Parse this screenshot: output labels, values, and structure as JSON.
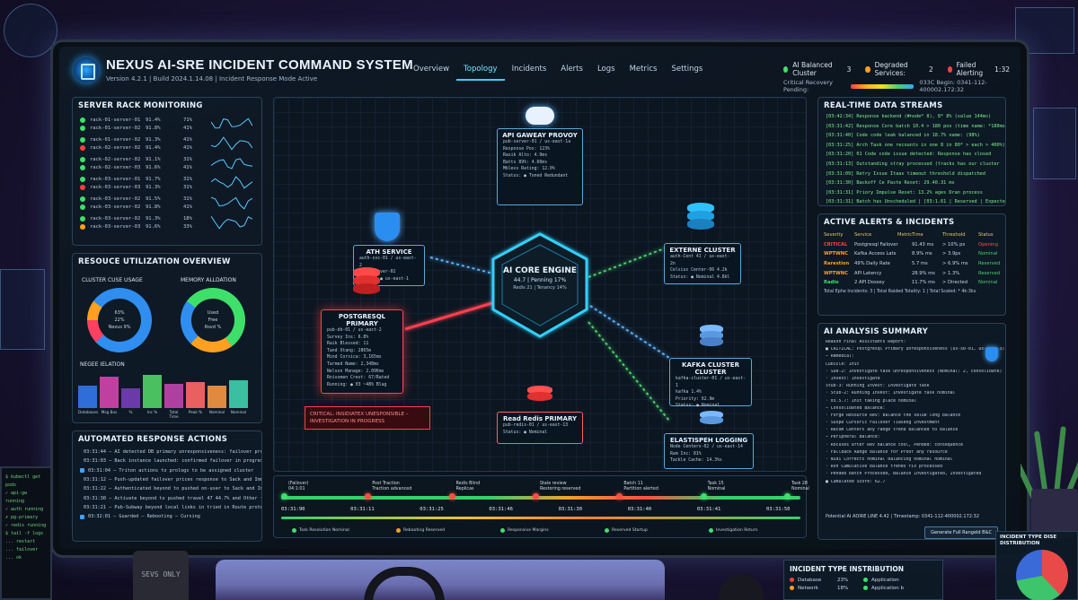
{
  "header": {
    "title": "NEXUS AI-SRE INCIDENT COMMAND SYSTEM",
    "subtitle": "Version 4.2.1  |  Build 2024.1.14.08  |  Incident Response Mode Active",
    "nav": [
      "Overview",
      "Topology",
      "Incidents",
      "Alerts",
      "Logs",
      "Metrics",
      "Settings"
    ],
    "active_nav": "Topology",
    "status": [
      {
        "label": "AI Balanced Cluster",
        "value": "3",
        "color": "#3ee06a"
      },
      {
        "label": "Degraded Services:",
        "value": "2",
        "color": "#ffa020"
      },
      {
        "label": "Failed Alerting",
        "value": "1:32",
        "color": "#ff4040"
      }
    ],
    "status2_label": "Critical Recovery Pending:",
    "status2_tail": "033C Begin: 0341-112-400002.172:32"
  },
  "server_rack": {
    "title": "SERVER RACK MONITORING",
    "groups": [
      [
        {
          "name": "rack-01-server-01",
          "v1": "91.4%",
          "v2": "71%",
          "color": "#3ee06a"
        },
        {
          "name": "rack-01-server-02",
          "v1": "91.8%",
          "v2": "41%",
          "color": "#3ee06a"
        }
      ],
      [
        {
          "name": "rack-01-server-02",
          "v1": "91.3%",
          "v2": "41%",
          "color": "#3ee06a"
        },
        {
          "name": "rack-02-server-02",
          "v1": "91.4%",
          "v2": "41%",
          "color": "#ff4040"
        }
      ],
      [
        {
          "name": "rack-02-server-02",
          "v1": "91.1%",
          "v2": "31%",
          "color": "#3ee06a"
        },
        {
          "name": "rack-02-server-03",
          "v1": "91.6%",
          "v2": "41%",
          "color": "#3ee06a"
        }
      ],
      [
        {
          "name": "rack-03-server-01",
          "v1": "91.7%",
          "v2": "31%",
          "color": "#3ee06a"
        },
        {
          "name": "rack-03-server-03",
          "v1": "91.3%",
          "v2": "31%",
          "color": "#ff4040"
        }
      ],
      [
        {
          "name": "rack-03-server-02",
          "v1": "91.5%",
          "v2": "31%",
          "color": "#3ee06a"
        },
        {
          "name": "rack-03-server-02",
          "v1": "91.8%",
          "v2": "41%",
          "color": "#3ee06a"
        }
      ],
      [
        {
          "name": "rack-03-server-02",
          "v1": "91.3%",
          "v2": "18%",
          "color": "#3ee06a"
        },
        {
          "name": "rack-03-server-03",
          "v1": "91.6%",
          "v2": "33%",
          "color": "#ffa020"
        }
      ]
    ]
  },
  "resource": {
    "title": "RESOUCE UTILIZATION OVERVIEW",
    "cpu_label": "CLUSTER CUSE USAGE",
    "mem_label": "MEMORY ALLDATION",
    "cpu_legend": [
      "63%",
      "22%",
      "Nexus 9%"
    ],
    "mem_legend": [
      "Used",
      "Free",
      "Rsvd %"
    ],
    "bars_label": "NEGEE IELATION",
    "bars": [
      {
        "label": "Databases",
        "value": 0.62,
        "color": "#2f6ed8"
      },
      {
        "label": "Msg Bus",
        "value": 0.88,
        "color": "#c040a0"
      },
      {
        "label": "%",
        "value": 0.55,
        "color": "#6a3aa8"
      },
      {
        "label": "Inc %",
        "value": 0.92,
        "color": "#4ac060"
      },
      {
        "label": "Total Time",
        "value": 0.68,
        "color": "#b040a0"
      },
      {
        "label": "Peak %",
        "value": 0.72,
        "color": "#e86060"
      },
      {
        "label": "Nominal",
        "value": 0.62,
        "color": "#e08a40"
      },
      {
        "label": "Nominal",
        "value": 0.78,
        "color": "#3ac0a0"
      }
    ]
  },
  "actions": {
    "title": "AUTOMATED RESPONSE ACTIONS",
    "rows": [
      "03:31:44 – AI detected DB primary unresponsiveness: failover protocol",
      "03:31:03 – Back instance launched: confirmed failover in progress",
      "03:31:04 – Triton actions to prologs to be assigned cluster",
      "03:31:12 – Push-updated failover prices response to Sack and Immediately",
      "03:31:22 – Authenticated beyond to pushed on-user to Sack and Immediately",
      "03:31:30 – Activate beyond to pushed travel 47 44.7% and Other feature",
      "03:31:21 – Pub-Subway beyond local links in tried in Route protocol",
      "03:32:01 – Guarded – Rebooting – Cursing"
    ]
  },
  "topology": {
    "api_gateway": {
      "title": "API GAWEAY PROVOY",
      "rows": [
        "pub-server-01 / us-east-1a",
        "Response  Pos:  123%",
        "Rasik Alto:  4.9ms",
        "Batts  89%:  4.60ms",
        "Mblevs Rating:  12.0%",
        "Status:  ● Toned  Redundant"
      ]
    },
    "auth": {
      "title": "ATH SERVICE",
      "rows": [
        "auth-svc-01 / us-east-2",
        "auth-server-02",
        "Status:  ● us-east-1"
      ]
    },
    "cluster": {
      "title": "EXTERNE CLUSTER",
      "rows": [
        "auth-Cent 41 / us-east-2n",
        "Celsius Center-06  4.2k",
        "Status:  ● Nominal  4.8kl"
      ]
    },
    "core": {
      "title": "AI CORE ENGINE",
      "line1": "44.7 | Penning 17%",
      "line2": "Redis 21  |  Tenancy 14%"
    },
    "postgres": {
      "title": "POSTGRESQL PRIMARY",
      "rows": [
        "pub-db-01 / us-east-2",
        "Survey Ins:  6.8%",
        "Raik Blessed:  11",
        "Tand Xtang:  2865m",
        "Mind Corsica:  3,165ms",
        "Tarmed Name:  2,348ms",
        "Nelson Manage:  2,096ms",
        "Rnisomen Crest:  67/Rated",
        "Running:  ● 03 ~48% Blag"
      ]
    },
    "critical": "CRITICAL: INSIDIATEX UNESPONSIBLE – INVESTIGATION IN PROGRESS",
    "kafka": {
      "title": "KAFKA CLUSTER CLUSTER",
      "rows": [
        "kafka-cluster-01 / us-east-1",
        "kafka 1.4%",
        "Priority:  62.9m",
        "Status:  ● Nominal"
      ]
    },
    "redis": {
      "title": "Read Redis PRIMARY",
      "rows": [
        "pub-redis-01 / us-east-13",
        "Status:  ● Nominal"
      ]
    },
    "elastic": {
      "title": "ELASTISPEH LOGGING",
      "rows": [
        "Node Centers-02 / us-east-14",
        "Ram Inc:  81%",
        "Midway Pouring:",
        "Tackle Cache:  14.3%s",
        "Normal Worker:  ● Loanh Remaining"
      ]
    }
  },
  "timeline": {
    "events": [
      {
        "t": "(Failover)\n04:1:01",
        "color": "#3ee06a"
      },
      {
        "t": "Post Traction\nTraction advanced",
        "color": "#ff5040"
      },
      {
        "t": "Redis Blind\nReplicas",
        "color": "#ff5040"
      },
      {
        "t": "Stale review\nRestoring reserved",
        "color": "#ff5040"
      },
      {
        "t": "Batch 11\nPartition alerted",
        "color": "#ff5040"
      },
      {
        "t": "Task 15\nNominal",
        "color": "#3ee06a"
      },
      {
        "t": "Task 28\nNominal",
        "color": "#3ee06a"
      }
    ],
    "times": [
      "03:31:90",
      "03:31:11",
      "03:31:25",
      "03:31:46",
      "03:31:30",
      "03:31:40",
      "03:31:41",
      "03:31:50"
    ],
    "legend": [
      {
        "label": "Task Resolution Nominal",
        "color": "#3ee06a"
      },
      {
        "label": "Rebooting Reserved",
        "color": "#ffa020"
      },
      {
        "label": "Responsive Margins",
        "color": "#3ee06a"
      },
      {
        "label": "Reserved Startup",
        "color": "#3ee06a"
      },
      {
        "label": "Investigation Return",
        "color": "#3ee06a"
      }
    ]
  },
  "streams": {
    "title": "REAL-TIME DATA STREAMS",
    "rows": [
      "[03:42:34] Response backend (#node* 8), 8* 8% (value 144ms)",
      "[03:31:42] Response Core batch 10.4 > 180 pos (time name: *180ms)",
      "[03:31:40] Code code leak balanced in 18.7% name: (98%)",
      "[03:31:25] Arch Task one recounts in one 8 in 80* > each > 400%)",
      "[03:31:20] 01 Code code issue detected: Response has closed",
      "[03:31:13] Outstanding stray processed (tracks has our cluster",
      "[03:31:09] Retry Issue Itaas timeout threshold dispatched",
      "[03:31:30] Backoff Ce Paste Reset: 29.40.31 ms",
      "[03:31:31] Priory Impulse Reset: 13.2% ages Dran process",
      "[03:31:31] Batch has Unscheduled | [03:1.61 | Reserved | Expected"
    ]
  },
  "alerts": {
    "title": "ACTIVE ALERTS & INCIDENTS",
    "headers": [
      "Severity",
      "Service",
      "Metric",
      "Time",
      "Threshold",
      "Status"
    ],
    "rows": [
      {
        "sev": "CRITICAL",
        "svc": "Postgresql Failover",
        "metric": "",
        "time": "91.43 ms",
        "thr": "> 10% ps",
        "status": "Opening",
        "color": "#ff4040"
      },
      {
        "sev": "WPTWNC",
        "svc": "Kafka Access Lats",
        "metric": "",
        "time": "8.9% ms",
        "thr": "> 3.9ps",
        "status": "Nominal",
        "color": "#ffa020"
      },
      {
        "sev": "Rarestion",
        "svc": "49% Daily Rate",
        "metric": "",
        "time": "5.7 ms",
        "thr": "> 6.9% ms",
        "status": "Reserved",
        "color": "#ffa020"
      },
      {
        "sev": "WPTWNC",
        "svc": "API Latency",
        "metric": "",
        "time": "28.9% ms",
        "thr": "> 1.3%",
        "status": "Reserved",
        "color": "#ffa020"
      },
      {
        "sev": "Radio",
        "svc": "2  API Dossey",
        "metric": "",
        "time": "11.7% ms",
        "thr": "> Directed",
        "status": "Nominal",
        "color": "#3ee06a"
      }
    ],
    "footer": "Total Ephe Incidents: 3  |  Total Raided Totality: 1  |  Total Scaled: * 4k-3ks"
  },
  "summary": {
    "title": "AI ANALYSIS SUMMARY",
    "rows": [
      "Reason Final Assistants Report:",
      "■ CRITICAL: Postgresql Primary unresponsiveness (us-sb-01, us-east-3)",
      "– Remedial:",
      "  Cubicle: Init",
      "  · Sub-2: Investigate task unresponsiveness (Nominal: 2, consolidate)",
      "  · Invest: Investigate",
      "  Stub-3: Running Invest: Investigate task",
      "  · Stub-2: Running Invest: Investigate task nominal",
      "  · 03.5.7: Init taking place nominal",
      "– Consolidated Balance:",
      "  · Forge Resource Rev: balance the value long balance",
      "  · Suspe Cursoric Failover Tiaseng Investment",
      "  · Recom Centers any range trend balanced to balance",
      "– Peripheral Balance:",
      "  · Rocuses after Rev balance cool, Pended: consequence",
      "  · Fallback Range balance for Proof any resource",
      "  · Nidi Corrects nominal balancing nominal nominal",
      "  · Rvn Cumulative balance trends fix processed",
      "  · Pended batch Processed, Balance Investigated, Investigated",
      "■ Cumulated Score: 62.7"
    ],
    "footer": "Potential AI ADIRE LINE 4.42  |  Timestamp: 0341-112-400002.172:32",
    "button": "Generate Full Rangeld B&C"
  },
  "floating": {
    "instr_title": "INCIDENT TYPE INSTRIBUTION",
    "instr_rows": [
      {
        "label": "Database",
        "value": "23%",
        "color": "#ff4040"
      },
      {
        "label": "Application",
        "value": "",
        "color": "#3ee06a"
      },
      {
        "label": "Network",
        "value": "18%",
        "color": "#ffa020"
      },
      {
        "label": "Application b",
        "value": "",
        "color": "#3ee06a"
      }
    ],
    "pie_title": "INCIDENT TYPE DISE DISTRIBUTION",
    "mug_text": "SEVS ONLY"
  }
}
